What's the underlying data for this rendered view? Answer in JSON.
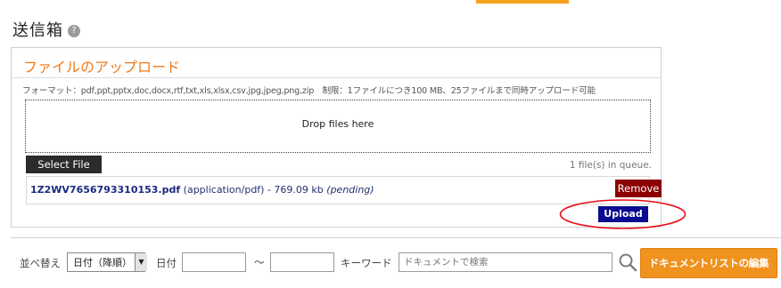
{
  "header": {
    "title": "送信箱",
    "help_glyph": "?",
    "accent_color": "#f6a020"
  },
  "upload_panel": {
    "title": "ファイルのアップロード",
    "format_note": "フォーマット：pdf,ppt,pptx,doc,docx,rtf,txt,xls,xlsx,csv,jpg,jpeg,png,zip　制限：1ファイルにつき100 MB、25ファイルまで同時アップロード可能",
    "drop_label": "Drop files here",
    "select_file_label": "Select File",
    "queue_status": "1 file(s) in queue.",
    "file": {
      "name": "1Z2WV7656793310153.pdf",
      "type": "(application/pdf)",
      "size": "- 769.09 kb",
      "status": "(pending)"
    },
    "remove_label": "Remove",
    "upload_label": "Upload",
    "annotation_color": "#e8101a"
  },
  "filter_bar": {
    "sort_label": "並べ替え",
    "sort_value": "日付（降順）",
    "date_label": "日付",
    "range_separator": "～",
    "keyword_label": "キーワード",
    "keyword_placeholder": "ドキュメントで検索",
    "edit_list_label": "ドキュメントリストの編集"
  },
  "icons": {
    "help": "help-icon",
    "search": "search-icon",
    "dropdown": "chevron-down-icon"
  }
}
